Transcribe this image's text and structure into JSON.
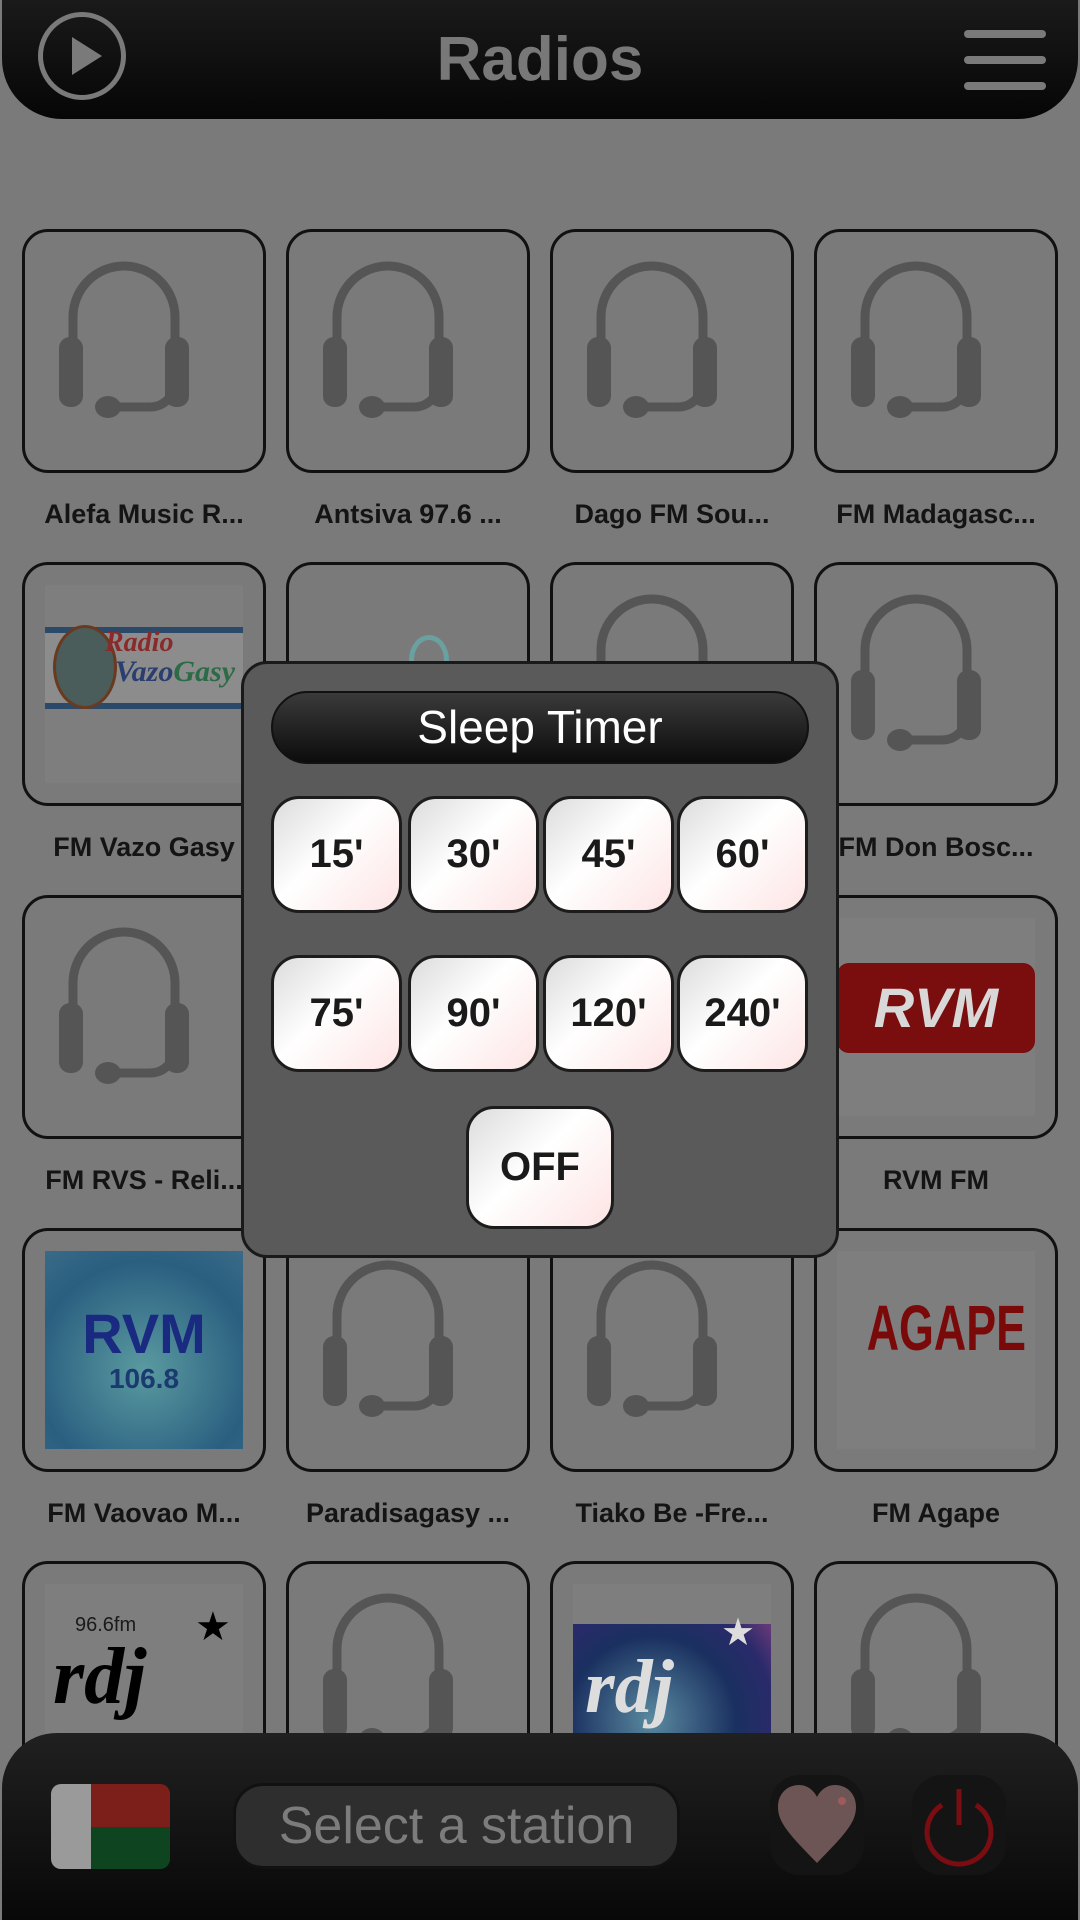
{
  "header": {
    "title": "Radios",
    "play_icon": "play-circle-icon",
    "menu_icon": "hamburger-menu-icon"
  },
  "stations": [
    {
      "label": "Alefa Music R...",
      "logo": "headset"
    },
    {
      "label": "Antsiva 97.6 ...",
      "logo": "headset"
    },
    {
      "label": "Dago FM Sou...",
      "logo": "headset"
    },
    {
      "label": "FM Madagasc...",
      "logo": "headset"
    },
    {
      "label": "FM Vazo Gasy",
      "logo": "vazogasy",
      "logo_text": "Radio Vazo Gasy .com"
    },
    {
      "label": "",
      "logo": "other"
    },
    {
      "label": "",
      "logo": "headset"
    },
    {
      "label": "FM Don Bosc...",
      "logo": "headset"
    },
    {
      "label": "FM RVS - Reli...",
      "logo": "headset"
    },
    {
      "label": "",
      "logo": "none"
    },
    {
      "label": "",
      "logo": "none"
    },
    {
      "label": "RVM FM",
      "logo": "rvm-red",
      "logo_text": "RVM"
    },
    {
      "label": "FM Vaovao M...",
      "logo": "rvm-blue",
      "logo_text": "RVM 106.8"
    },
    {
      "label": "Paradisagasy ...",
      "logo": "headset"
    },
    {
      "label": "Tiako Be -Fre...",
      "logo": "headset"
    },
    {
      "label": "FM Agape",
      "logo": "agape",
      "logo_text": "AGAPE"
    },
    {
      "label": "",
      "logo": "rdj",
      "logo_text": "96.6fm rdj"
    },
    {
      "label": "",
      "logo": "headset"
    },
    {
      "label": "",
      "logo": "rdj-globe",
      "logo_text": "rdj"
    },
    {
      "label": "",
      "logo": "headset"
    }
  ],
  "sleep_timer": {
    "title": "Sleep Timer",
    "options": [
      "15'",
      "30'",
      "45'",
      "60'",
      "75'",
      "90'",
      "120'",
      "240'"
    ],
    "off_label": "OFF"
  },
  "bottom_bar": {
    "flag_icon": "madagascar-flag-icon",
    "station_placeholder": "Select a station",
    "favorite_icon": "heart-icon",
    "power_icon": "power-icon"
  },
  "colors": {
    "flag_white": "#9a9a9a",
    "flag_red": "#7c1f1a",
    "flag_green": "#0f4420",
    "power": "#7a0d12",
    "heart": "#6e5555"
  }
}
